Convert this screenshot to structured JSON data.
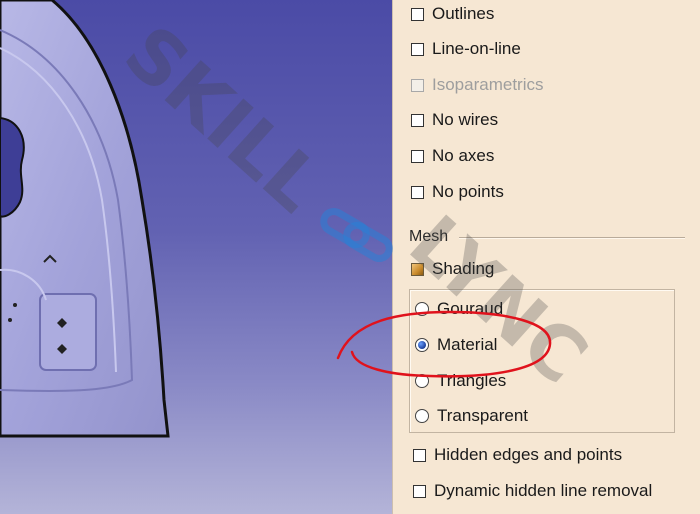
{
  "options": {
    "items": [
      {
        "label": "Outlines",
        "type": "checkbox",
        "checked": false,
        "enabled": true
      },
      {
        "label": "Line-on-line",
        "type": "checkbox",
        "checked": false,
        "enabled": true
      },
      {
        "label": "Isoparametrics",
        "type": "checkbox",
        "checked": false,
        "enabled": false
      },
      {
        "label": "No wires",
        "type": "checkbox",
        "checked": false,
        "enabled": true
      },
      {
        "label": "No axes",
        "type": "checkbox",
        "checked": false,
        "enabled": true
      },
      {
        "label": "No points",
        "type": "checkbox",
        "checked": false,
        "enabled": true
      }
    ]
  },
  "mesh": {
    "title": "Mesh",
    "shading": {
      "label": "Shading",
      "checked": true
    },
    "modes": [
      {
        "label": "Gouraud",
        "selected": false
      },
      {
        "label": "Material",
        "selected": true
      },
      {
        "label": "Triangles",
        "selected": false
      },
      {
        "label": "Transparent",
        "selected": false
      }
    ]
  },
  "extra": {
    "hidden_edges": {
      "label": "Hidden edges and points",
      "checked": false
    },
    "dynamic_hidden": {
      "label": "Dynamic hidden line removal",
      "checked": false
    }
  },
  "watermark": {
    "text_left": "SKILL",
    "text_right": "LYNC"
  },
  "colors": {
    "panel_bg": "#f6e7d3",
    "viewport_top": "#4b4ba6",
    "part": "#a4a4dc",
    "annotation": "#e0121c",
    "watermark_link": "#2a7fd6"
  }
}
